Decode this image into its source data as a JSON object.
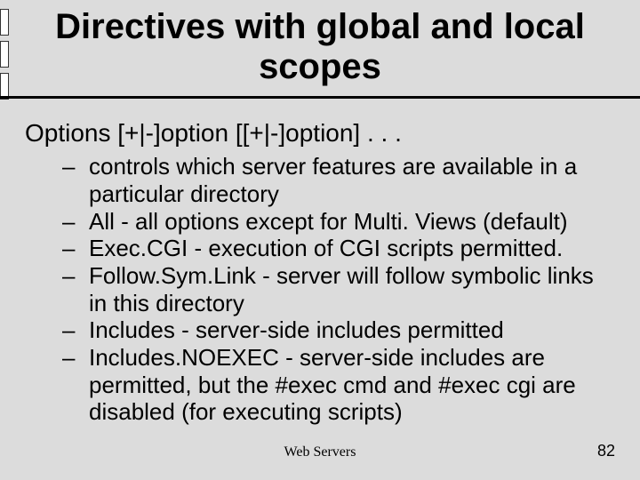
{
  "title": "Directives with global and local scopes",
  "level1": "Options [+|-]option [[+|-]option] . . .",
  "bullets": [
    "controls which server features are available in a particular directory",
    "All - all options except for Multi. Views (default)",
    "Exec.CGI - execution of CGI scripts permitted.",
    "Follow.Sym.Link - server will follow symbolic links in this directory",
    "Includes - server-side includes permitted",
    "Includes.NOEXEC - server-side includes are permitted, but the #exec cmd and #exec cgi are disabled (for executing scripts)"
  ],
  "footer_center": "Web Servers",
  "page_number": "82"
}
